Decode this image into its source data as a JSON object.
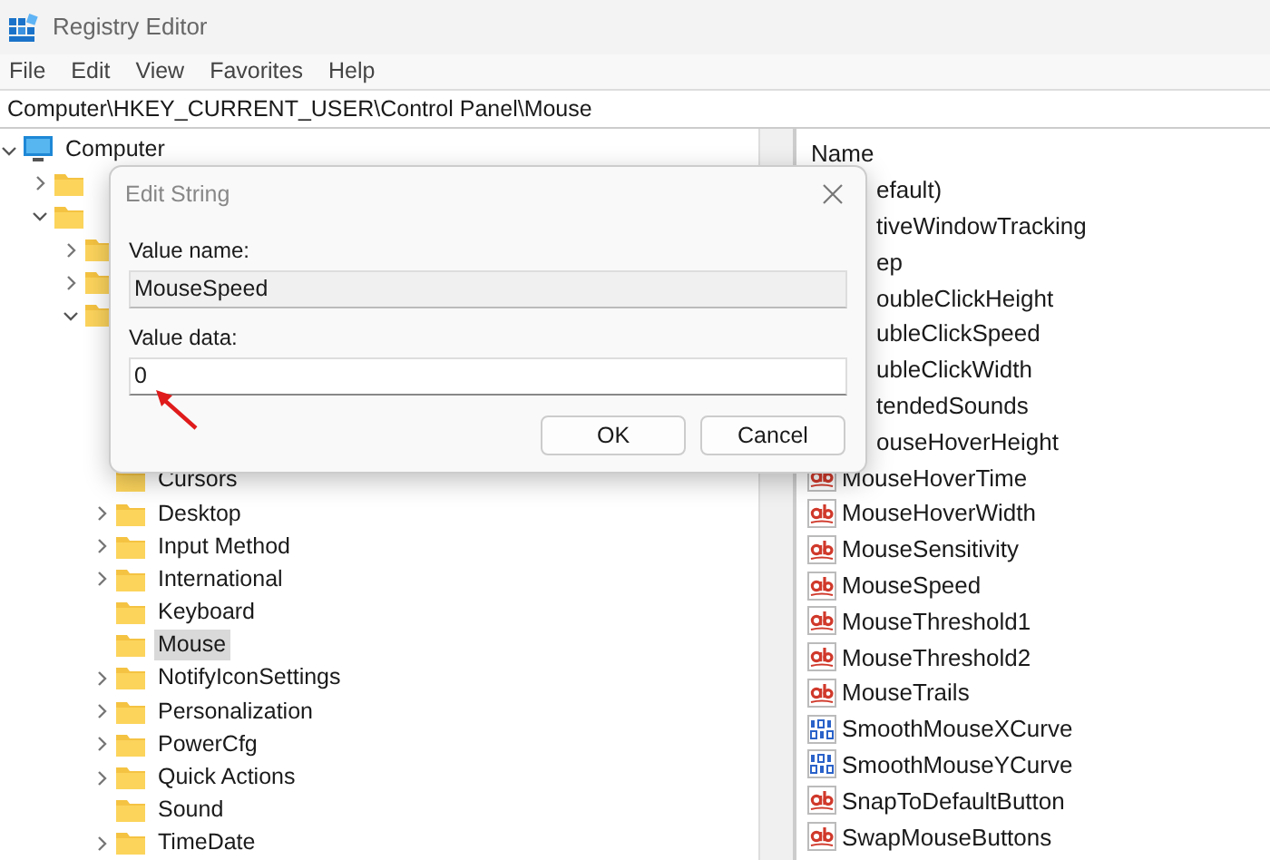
{
  "window": {
    "title": "Registry Editor"
  },
  "menu": [
    "File",
    "Edit",
    "View",
    "Favorites",
    "Help"
  ],
  "address": "Computer\\HKEY_CURRENT_USER\\Control Panel\\Mouse",
  "tree": [
    {
      "label": "Computer",
      "kind": "computer",
      "expanded": true,
      "children": [
        {
          "kind": "covered",
          "expanded": false
        },
        {
          "kind": "covered",
          "expanded": true,
          "children": [
            {
              "kind": "covered",
              "expanded": false
            },
            {
              "kind": "covered",
              "expanded": false
            },
            {
              "kind": "covered",
              "expanded": true,
              "children": [
                {
                  "label": "Cursors",
                  "kind": "folder",
                  "expandable": false,
                  "selected": false
                },
                {
                  "label": "Desktop",
                  "kind": "folder",
                  "expandable": true,
                  "selected": false
                },
                {
                  "label": "Input Method",
                  "kind": "folder",
                  "expandable": true,
                  "selected": false
                },
                {
                  "label": "International",
                  "kind": "folder",
                  "expandable": true,
                  "selected": false
                },
                {
                  "label": "Keyboard",
                  "kind": "folder",
                  "expandable": false,
                  "selected": false
                },
                {
                  "label": "Mouse",
                  "kind": "folder",
                  "expandable": false,
                  "selected": true
                },
                {
                  "label": "NotifyIconSettings",
                  "kind": "folder",
                  "expandable": true,
                  "selected": false
                },
                {
                  "label": "Personalization",
                  "kind": "folder",
                  "expandable": true,
                  "selected": false
                },
                {
                  "label": "PowerCfg",
                  "kind": "folder",
                  "expandable": true,
                  "selected": false
                },
                {
                  "label": "Quick Actions",
                  "kind": "folder",
                  "expandable": true,
                  "selected": false
                },
                {
                  "label": "Sound",
                  "kind": "folder",
                  "expandable": false,
                  "selected": false
                },
                {
                  "label": "TimeDate",
                  "kind": "folder",
                  "expandable": true,
                  "selected": false
                }
              ]
            }
          ]
        }
      ]
    }
  ],
  "values": {
    "column": "Name",
    "rows": [
      {
        "name": "efault)",
        "kind": "covered"
      },
      {
        "name": "tiveWindowTracking",
        "kind": "covered"
      },
      {
        "name": "ep",
        "kind": "covered"
      },
      {
        "name": "oubleClickHeight",
        "kind": "covered"
      },
      {
        "name": "ubleClickSpeed",
        "kind": "covered"
      },
      {
        "name": "ubleClickWidth",
        "kind": "covered"
      },
      {
        "name": "tendedSounds",
        "kind": "covered"
      },
      {
        "name": "ouseHoverHeight",
        "kind": "covered"
      },
      {
        "name": "MouseHoverTime",
        "kind": "string"
      },
      {
        "name": "MouseHoverWidth",
        "kind": "string"
      },
      {
        "name": "MouseSensitivity",
        "kind": "string"
      },
      {
        "name": "MouseSpeed",
        "kind": "string"
      },
      {
        "name": "MouseThreshold1",
        "kind": "string"
      },
      {
        "name": "MouseThreshold2",
        "kind": "string"
      },
      {
        "name": "MouseTrails",
        "kind": "string"
      },
      {
        "name": "SmoothMouseXCurve",
        "kind": "binary"
      },
      {
        "name": "SmoothMouseYCurve",
        "kind": "binary"
      },
      {
        "name": "SnapToDefaultButton",
        "kind": "string"
      },
      {
        "name": "SwapMouseButtons",
        "kind": "string"
      }
    ]
  },
  "dialog": {
    "title": "Edit String",
    "name_label": "Value name:",
    "name_value": "MouseSpeed",
    "data_label": "Value data:",
    "data_value": "0",
    "buttons": [
      "OK",
      "Cancel"
    ]
  }
}
